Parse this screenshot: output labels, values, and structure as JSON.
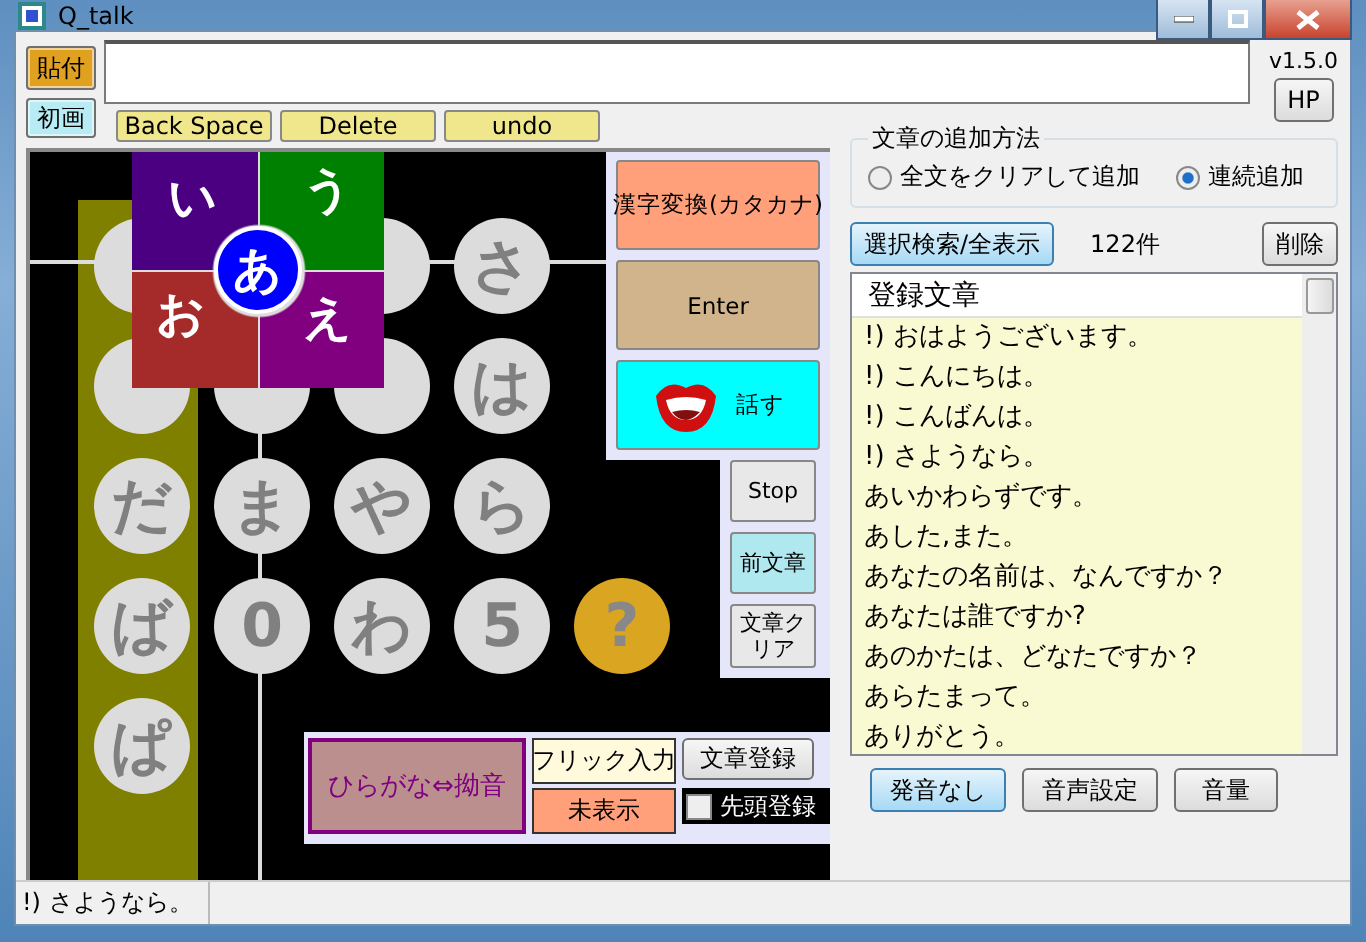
{
  "window": {
    "title": "Q_talk"
  },
  "paste_button": "貼付",
  "reset_button": "初画",
  "version": "v1.5.0",
  "hp_button": "HP",
  "edit_buttons": [
    "Back Space",
    "Delete",
    "undo"
  ],
  "flick_popup": {
    "center": "あ",
    "petals": [
      {
        "label": "い",
        "color": "#4b0082"
      },
      {
        "label": "う",
        "color": "#008000"
      },
      {
        "label": "お",
        "color": "#a52a2a"
      },
      {
        "label": "え",
        "color": "#800080"
      }
    ]
  },
  "keys": [
    [
      {
        "kind": "blank"
      },
      {
        "kind": "blank"
      },
      {
        "kind": "blank"
      },
      {
        "kind": "kana",
        "label": "さ"
      }
    ],
    [
      {
        "kind": "blank"
      },
      {
        "kind": "blank"
      },
      {
        "kind": "blank"
      },
      {
        "kind": "kana",
        "label": "は"
      }
    ],
    [
      {
        "kind": "kana",
        "label": "だ"
      },
      {
        "kind": "kana",
        "label": "ま"
      },
      {
        "kind": "kana",
        "label": "や"
      },
      {
        "kind": "kana",
        "label": "ら"
      }
    ],
    [
      {
        "kind": "kana",
        "label": "ば"
      },
      {
        "kind": "kana",
        "label": "0"
      },
      {
        "kind": "kana",
        "label": "わ"
      },
      {
        "kind": "kana",
        "label": "5"
      },
      {
        "kind": "help",
        "label": "?"
      }
    ],
    [
      {
        "kind": "kana",
        "label": "ぱ"
      }
    ]
  ],
  "action_buttons": [
    {
      "label": "漢字変換(カタカナ)",
      "kind": "plain",
      "color": "#ffa07a"
    },
    {
      "label": "Enter",
      "kind": "plain",
      "color": "#d2b48c"
    },
    {
      "label": "話す",
      "kind": "speak",
      "color": "#00ffff"
    }
  ],
  "side_buttons": [
    {
      "label": "Stop",
      "color": "#e8e8e8"
    },
    {
      "label": "前文章",
      "color": "#b0e8f0"
    },
    {
      "label": "文章クリア",
      "color": "#e8e8e8"
    }
  ],
  "bottom_panel": {
    "toggle_button": "ひらがな⇔拗音",
    "input_mode": "フリック入力",
    "display_mode": "未表示",
    "register_button": "文章登録",
    "head_register": {
      "label": "先頭登録",
      "checked": false
    }
  },
  "add_method": {
    "title": "文章の追加方法",
    "options": [
      {
        "label": "全文をクリアして追加",
        "selected": false
      },
      {
        "label": "連続追加",
        "selected": true
      }
    ]
  },
  "search_button": {
    "label": "選択検索/全表示",
    "highlighted": true
  },
  "count": "122件",
  "delete_button": "削除",
  "list": {
    "header": "登録文章",
    "items": [
      "!) おはようございます。",
      "!) こんにちは。",
      "!) こんばんは。",
      "!) さようなら。",
      "あいかわらずです。",
      "あした,また。",
      "あなたの名前は、なんですか？",
      "あなたは誰ですか?",
      "あのかたは、どなたですか？",
      "あらたまって。",
      "ありがとう。"
    ]
  },
  "sound_buttons": [
    {
      "label": "発音なし",
      "highlighted": true
    },
    {
      "label": "音声設定",
      "highlighted": false
    },
    {
      "label": "音量",
      "highlighted": false
    }
  ],
  "status_bar": "!) さようなら。"
}
